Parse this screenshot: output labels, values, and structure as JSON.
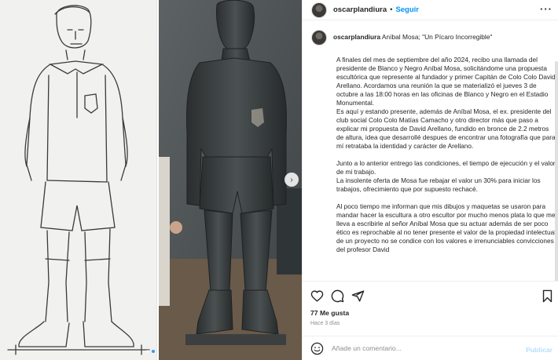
{
  "post": {
    "username": "oscarplandiura",
    "separator": "•",
    "follow_label": "Seguir",
    "more_icon": "more-horizontal-icon"
  },
  "caption": {
    "username": "oscarplandiura",
    "title": "Aníbal Mosa; \"Un Pícaro Incorregible\"",
    "paragraphs": [
      [
        "A finales del mes de septiembre del año 2024, recibo una llamada del presidente de Blanco y Negro Aníbal Mosa, solicitándome una propuesta escultórica que represente al fundador y primer Capitán de Colo Colo David Arellano. Acordamos una reunión la que se materializó el jueves 3 de octubre a las 18:00 horas en las oficinas de Blanco y Negro en el Estadio Monumental.",
        "Es aquí y estando presente, además de Aníbal Mosa, el ex. presidente del club social Colo Colo Matías Camacho y otro director más que paso a explicar mi propuesta de David Arellano, fundido en bronce de 2.2 metros de altura, idea que desarrollé despues de encontrar una fotografía que para mí retrataba la identidad y carácter de Arellano."
      ],
      [
        "Junto a lo anterior entrego las condiciones, el tiempo de ejecución y el valor de mi trabajo.",
        "La insolente oferta de Mosa fue rebajar el valor un 30% para iniciar los trabajos, ofrecimiento que por supuesto rechacé."
      ],
      [
        "Al poco tiempo me informan que mis dibujos y maquetas se usaron para mandar hacer la escultura a otro escultor por mucho menos plata lo que me lleva a escribirle al señor Aníbal Mosa que su actuar además de ser poco ético es reprochable al no tener presente el valor de la propiedad intelectual de un proyecto no se condice con los valores e irrenunciables convicciones del profesor David"
      ]
    ]
  },
  "stats": {
    "likes": "77 Me gusta",
    "time": "Hace 3 días"
  },
  "comment": {
    "placeholder": "Añade un comentario...",
    "publish_label": "Publicar"
  },
  "media": {
    "slides": 2,
    "active_slide": 2
  }
}
